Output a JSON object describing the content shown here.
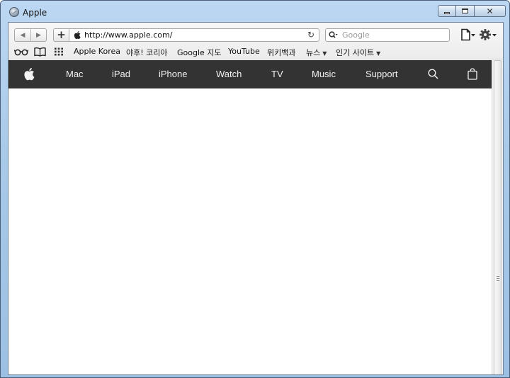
{
  "window": {
    "title": "Apple",
    "close_glyph": "✕"
  },
  "toolbar": {
    "back_glyph": "◀",
    "forward_glyph": "▶",
    "add_glyph": "+",
    "url": "http://www.apple.com/",
    "reload_glyph": "↻",
    "search_placeholder": "Google"
  },
  "bookmarks": [
    {
      "label": "Apple Korea"
    },
    {
      "label": "야후! 코리아"
    },
    {
      "label": "Google 지도"
    },
    {
      "label": "YouTube"
    },
    {
      "label": "위키백과"
    },
    {
      "label": "뉴스",
      "has_menu": true
    },
    {
      "label": "인기 사이트",
      "has_menu": true
    }
  ],
  "bookmark_caret": "▼",
  "globalnav": {
    "items": [
      {
        "label": "Mac"
      },
      {
        "label": "iPad"
      },
      {
        "label": "iPhone"
      },
      {
        "label": "Watch"
      },
      {
        "label": "TV"
      },
      {
        "label": "Music"
      },
      {
        "label": "Support"
      }
    ],
    "icons": [
      "apple-logo-icon",
      "search-icon",
      "shopping-bag-icon"
    ],
    "background": "#333333"
  },
  "colors": {
    "nav_background": "#333333",
    "nav_text": "#f2f2f2",
    "frame": "#a9cae9"
  }
}
